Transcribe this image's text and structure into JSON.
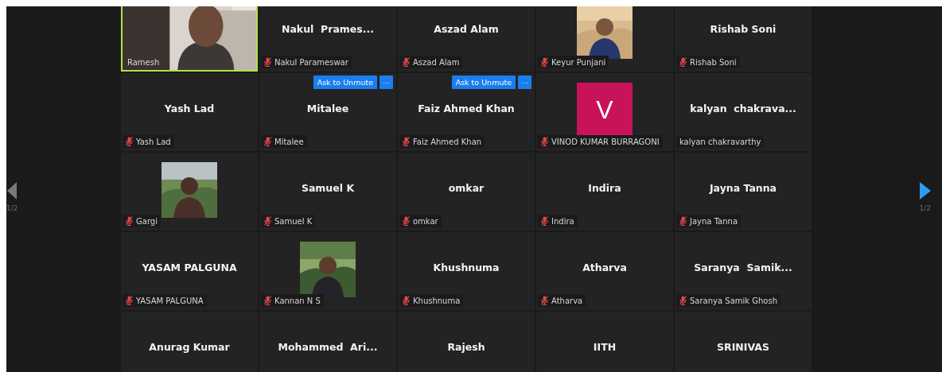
{
  "pagers": [
    {
      "label": "1/2",
      "enabled": false
    },
    {
      "label": "1/2",
      "enabled": true
    }
  ],
  "tiles": [
    {
      "kind": "video",
      "label": "Ramesh",
      "muted": false,
      "speaking": true
    },
    {
      "kind": "name",
      "display_name": "Nakul  Prames...",
      "label": "Nakul Parameswar",
      "muted": true,
      "speaking": false
    },
    {
      "kind": "name",
      "display_name": "Aszad Alam",
      "label": "Aszad Alam",
      "muted": true,
      "speaking": false
    },
    {
      "label": "Keyur Punjani",
      "muted": true,
      "speaking": false
    },
    {
      "kind": "name",
      "display_name": "Rishab Soni",
      "label": "Rishab Soni",
      "muted": true,
      "speaking": false
    },
    {
      "kind": "name",
      "display_name": "Yash Lad",
      "label": "Yash Lad",
      "muted": true,
      "speaking": false
    },
    {
      "kind": "name",
      "display_name": "Mitalee",
      "label": "Mitalee",
      "muted": true,
      "speaking": false,
      "hover_controls": {
        "button": "Ask to Unmute",
        "more": "···"
      }
    },
    {
      "kind": "name",
      "display_name": "Faiz Ahmed Khan",
      "label": "Faiz Ahmed Khan",
      "muted": true,
      "speaking": false,
      "hover_controls": {
        "button": "Ask to Unmute",
        "more": "···"
      }
    },
    {
      "kind": "avatar",
      "letter": "V",
      "color": "#c8135a",
      "label": "VINOD KUMAR BURRAGONI",
      "muted": true,
      "speaking": false
    },
    {
      "kind": "name",
      "display_name": "kalyan  chakrava...",
      "label": "kalyan chakravarthy",
      "muted": false,
      "speaking": false
    },
    {
      "label": "Gargi",
      "muted": true,
      "speaking": false
    },
    {
      "kind": "name",
      "display_name": "Samuel K",
      "label": "Samuel K",
      "muted": true,
      "speaking": false
    },
    {
      "kind": "name",
      "display_name": "omkar",
      "label": "omkar",
      "muted": true,
      "speaking": false
    },
    {
      "kind": "name",
      "display_name": "Indira",
      "label": "Indira",
      "muted": true,
      "speaking": false
    },
    {
      "kind": "name",
      "display_name": "Jayna Tanna",
      "label": "Jayna Tanna",
      "muted": true,
      "speaking": false
    },
    {
      "kind": "name",
      "display_name": "YASAM PALGUNA",
      "label": "YASAM PALGUNA",
      "muted": true,
      "speaking": false
    },
    {
      "label": "Kannan N S",
      "muted": true,
      "speaking": false
    },
    {
      "kind": "name",
      "display_name": "Khushnuma",
      "label": "Khushnuma",
      "muted": true,
      "speaking": false
    },
    {
      "kind": "name",
      "display_name": "Atharva",
      "label": "Atharva",
      "muted": true,
      "speaking": false
    },
    {
      "kind": "name",
      "display_name": "Saranya  Samik...",
      "label": "Saranya Samik Ghosh",
      "muted": true,
      "speaking": false
    },
    {
      "kind": "name",
      "display_name": "Anurag Kumar"
    },
    {
      "kind": "name",
      "display_name": "Mohammed  Ari..."
    },
    {
      "kind": "name",
      "display_name": "Rajesh"
    },
    {
      "kind": "name",
      "display_name": "IITH"
    },
    {
      "kind": "name",
      "display_name": "SRINIVAS"
    }
  ]
}
